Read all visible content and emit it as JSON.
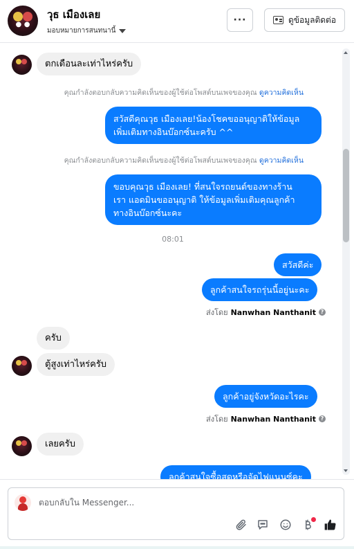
{
  "header": {
    "contact_name": "วุธ เมืองเลย",
    "assign_label": "มอบหมายการสนทนานี้",
    "more_label": "···",
    "contact_info_label": "ดูข้อมูลติดต่อ"
  },
  "thread": {
    "messages": [
      {
        "from": "customer",
        "text": "ตกเดือนละเท่าไหร่ครับ"
      },
      {
        "kind": "notice",
        "text": "คุณกำลังตอบกลับความคิดเห็นของผู้ใช้ต่อโพสต์บนเพจของคุณ",
        "link": "ดูความคิดเห็น"
      },
      {
        "from": "page",
        "lines": [
          "สวัสดีคุณวุธ เมืองเลย!น้องโชคขออนุญาติให้ข้อมูล",
          "เพิ่มเติมทางอินบ๊อกซ์นะครับ ^^"
        ]
      },
      {
        "kind": "notice",
        "text": "คุณกำลังตอบกลับความคิดเห็นของผู้ใช้ต่อโพสต์บนเพจของคุณ",
        "link": "ดูความคิดเห็น"
      },
      {
        "from": "page",
        "lines": [
          "ขอบคุณวุธ เมืองเลย! ที่สนใจรถยนต์ของทางร้าน",
          "เรา แอดมินขออนุญาติ ให้ข้อมูลเพิ่มเติมคุณลูกค้า",
          "ทางอินบ๊อกซ์นะคะ"
        ]
      },
      {
        "kind": "timestamp",
        "text": "08:01"
      },
      {
        "from": "page",
        "text": "สวัสดีค่ะ"
      },
      {
        "from": "page",
        "text": "ลูกค้าสนใจรถรุ่นนี้อยู่นะคะ"
      },
      {
        "kind": "sentby",
        "prefix": "ส่งโดย",
        "name": "Nanwhan Nanthanit"
      },
      {
        "from": "customer",
        "text": "ครับ"
      },
      {
        "from": "customer",
        "text": "ตู้สูงเท่าไหร่ครับ"
      },
      {
        "from": "page",
        "text": "ลูกค้าอยู่จังหวัดอะไรคะ"
      },
      {
        "kind": "sentby",
        "prefix": "ส่งโดย",
        "name": "Nanwhan Nanthanit"
      },
      {
        "from": "customer",
        "text": "เลยครับ"
      },
      {
        "from": "page",
        "text": "ลูกค้าสนใจซื้อสดหรือจัดไฟแนนซ์คะ"
      }
    ]
  },
  "composer": {
    "placeholder": "ตอบกลับใน Messenger...",
    "icons": [
      "paperclip-icon",
      "chat-bubble-icon",
      "emoji-icon",
      "baht-icon",
      "thumbs-up-icon"
    ],
    "accent": "#0a7cff",
    "notif_color": "#f02849"
  }
}
